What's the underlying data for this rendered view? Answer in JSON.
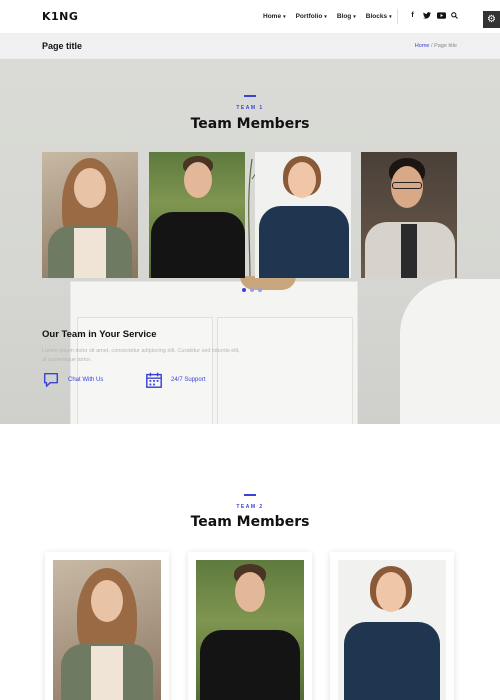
{
  "header": {
    "logo": "K1NG",
    "nav": [
      {
        "label": "Home",
        "caret": "▾"
      },
      {
        "label": "Portfolio",
        "caret": "▾"
      },
      {
        "label": "Blog",
        "caret": "▾"
      },
      {
        "label": "Blocks",
        "caret": "▾"
      }
    ],
    "social": {
      "facebook": "f",
      "twitter": "t",
      "youtube": "▶",
      "search": "⚲"
    },
    "settings_icon": "⚙"
  },
  "page_title_bar": {
    "title": "Page title",
    "breadcrumb": {
      "home": "Home",
      "separator": "/",
      "current": "Page title"
    }
  },
  "team1": {
    "eyebrow": "TEAM 1",
    "heading": "Team Members",
    "carousel_dots": 3,
    "active_dot": 1
  },
  "service": {
    "title": "Our Team in Your Service",
    "text": "Lorem ipsum dolor sit amet, consectetur adipiscing elit. Curabitur sed lobortis elit, ut scelerisque tortor.",
    "features": [
      {
        "icon": "chat-bubble-icon",
        "label": "Chat With Us"
      },
      {
        "icon": "calendar-icon",
        "label": "24/7 Support"
      }
    ]
  },
  "team2": {
    "eyebrow": "TEAM 2",
    "heading": "Team Members"
  },
  "colors": {
    "accent": "#3a43d6",
    "dark": "#111111",
    "bar": "#f0f0f0"
  }
}
